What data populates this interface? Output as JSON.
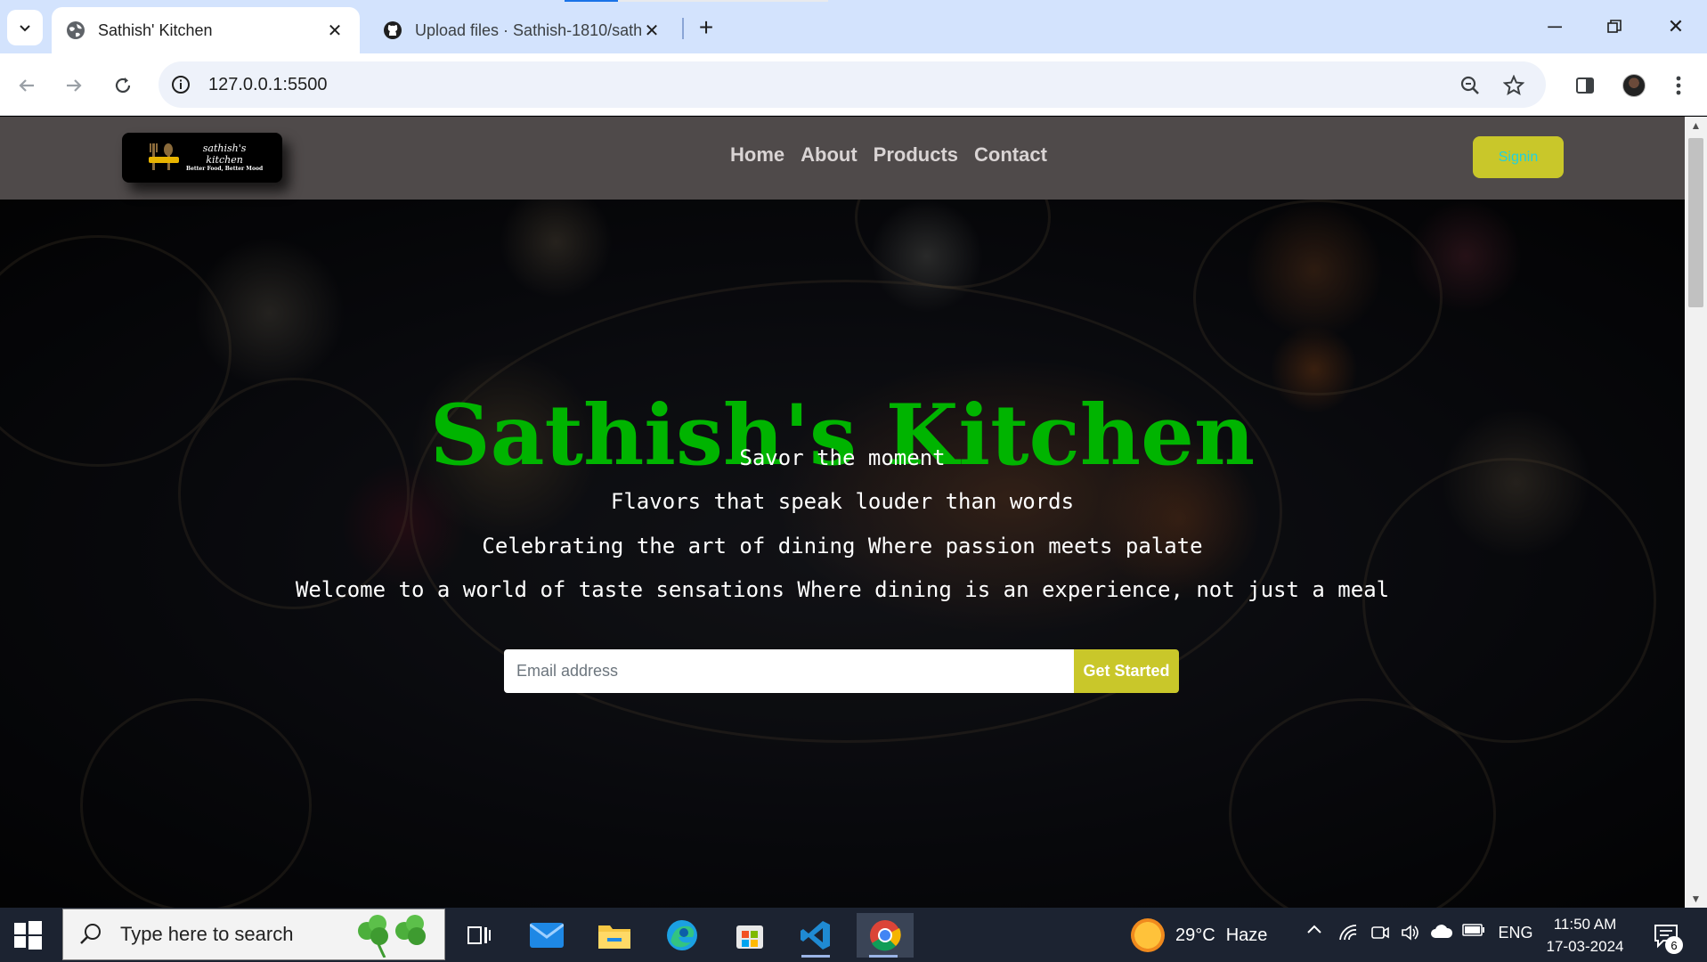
{
  "browser": {
    "tabs": [
      {
        "title": "Sathish' Kitchen",
        "active": true,
        "icon": "globe-icon"
      },
      {
        "title": "Upload files · Sathish-1810/sath",
        "active": false,
        "icon": "github-icon"
      }
    ],
    "url": "127.0.0.1:5500"
  },
  "site": {
    "logo": {
      "line1": "sathish's",
      "line2": "kitchen",
      "tagline": "Better Food, Better Mood"
    },
    "nav": [
      "Home",
      "About",
      "Products",
      "Contact"
    ],
    "signin_label": "Signin",
    "hero": {
      "title": "Sathish's Kitchen",
      "taglines": [
        "Savor the moment",
        "Flavors that speak louder than words",
        "Celebrating the art of dining Where passion meets palate",
        "Welcome to a world of taste sensations Where dining is an experience, not just a meal"
      ],
      "email_placeholder": "Email address",
      "cta_label": "Get Started"
    },
    "colors": {
      "title": "#00b400",
      "signin_bg": "#c9c72a",
      "signin_text": "#1fd1e0",
      "nav_bg": "#4f4a4a"
    }
  },
  "taskbar": {
    "search_placeholder": "Type here to search",
    "weather": {
      "temp": "29°C",
      "condition": "Haze"
    },
    "language": "ENG",
    "time": "11:50 AM",
    "date": "17-03-2024",
    "notification_count": "6"
  }
}
